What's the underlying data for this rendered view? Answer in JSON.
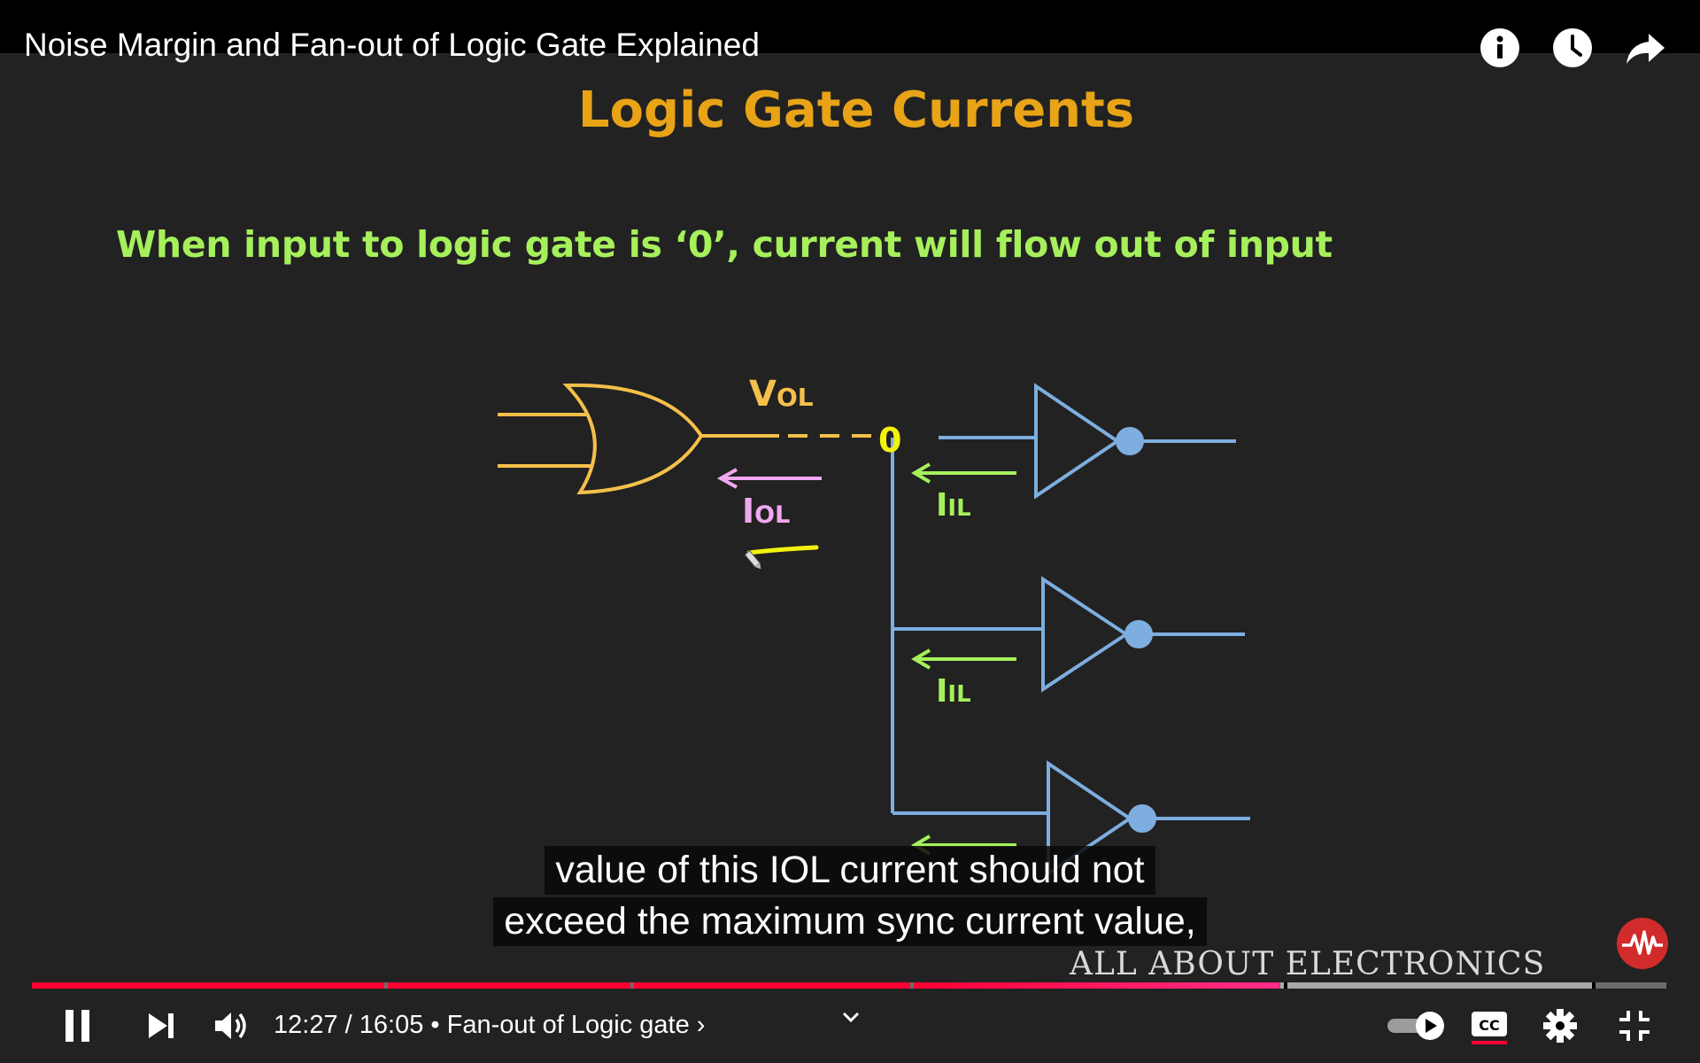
{
  "player": {
    "title": "Noise Margin and Fan-out of Logic Gate Explained",
    "top_icons": [
      "info-icon",
      "clock-icon",
      "share-icon"
    ],
    "caption_lines": [
      "value of this IOL current should not",
      "exceed the maximum sync current value,"
    ],
    "watermark": "ALL ABOUT ELECTRONICS",
    "time_current": "12:27",
    "time_total": "16:05",
    "time_separator": "/",
    "chapter_sep": "•",
    "chapter": "Fan-out of Logic gate",
    "chapter_chevron": "›",
    "progress_played": 0.7745,
    "controls": [
      "pause-icon",
      "next-icon",
      "volume-icon",
      "autoplay-toggle",
      "cc-icon",
      "settings-icon",
      "exit-fullscreen-icon"
    ],
    "colors": {
      "accent": "#ff0033",
      "progress_chapter_hover": "#ff2e8a"
    }
  },
  "slide": {
    "title": "Logic Gate Currents",
    "subtitle": "When input to logic gate is ‘0’, current will flow out of input",
    "labels": {
      "vol_main": "V",
      "vol_sub": "OL",
      "iol_main": "I",
      "iol_sub": "OL",
      "iil_main": "I",
      "iil_sub": "IL"
    },
    "marker": "0",
    "colors": {
      "title": "#e8a317",
      "subtitle": "#a6f05c",
      "or_gate": "#f5c04a",
      "inverter": "#7eaee0",
      "iol_arrow": "#f1a8f1",
      "iil_arrow": "#a6f05c",
      "highlight": "#f2f20f"
    }
  }
}
